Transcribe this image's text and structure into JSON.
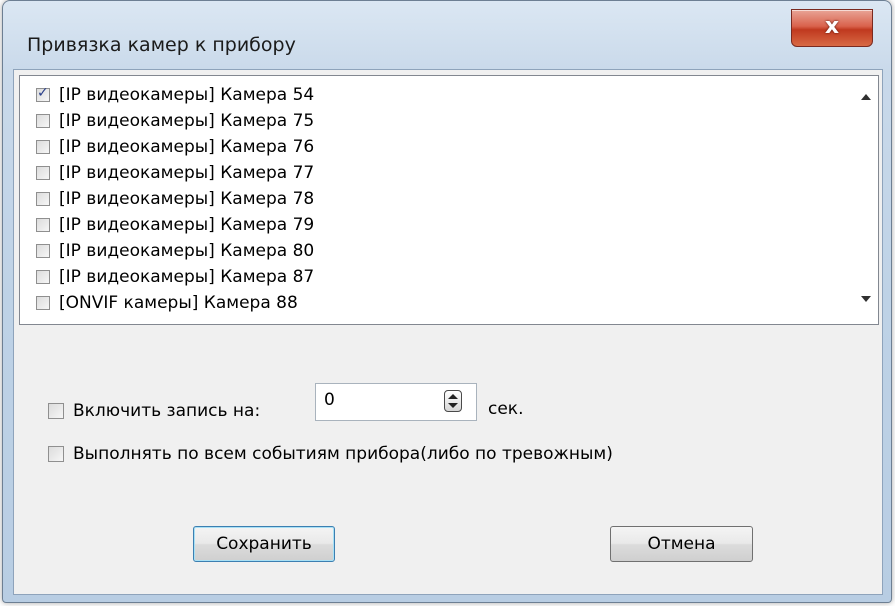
{
  "window": {
    "title": "Привязка камер к прибору",
    "close_symbol": "x"
  },
  "camera_list": {
    "items": [
      {
        "label": "[IP видеокамеры] Камера 54",
        "checked": true
      },
      {
        "label": "[IP видеокамеры] Камера 75",
        "checked": false
      },
      {
        "label": "[IP видеокамеры] Камера 76",
        "checked": false
      },
      {
        "label": "[IP видеокамеры] Камера 77",
        "checked": false
      },
      {
        "label": "[IP видеокамеры] Камера 78",
        "checked": false
      },
      {
        "label": "[IP видеокамеры] Камера 79",
        "checked": false
      },
      {
        "label": "[IP видеокамеры] Камера 80",
        "checked": false
      },
      {
        "label": "[IP видеокамеры] Камера 87",
        "checked": false
      },
      {
        "label": "[ONVIF камеры] Камера 88",
        "checked": false
      }
    ]
  },
  "options": {
    "record_label": "Включить запись на:",
    "record_checked": false,
    "record_seconds": "0",
    "seconds_unit": "сек.",
    "all_events_label": "Выполнять по всем событиям прибора(либо по тревожным)",
    "all_events_checked": false
  },
  "buttons": {
    "save_label": "Сохранить",
    "cancel_label": "Отмена"
  },
  "icons": {
    "close": "close-icon",
    "spin": "spin-updown-icon",
    "scroll_up": "scroll-up-arrow-icon",
    "scroll_down": "scroll-down-arrow-icon"
  }
}
